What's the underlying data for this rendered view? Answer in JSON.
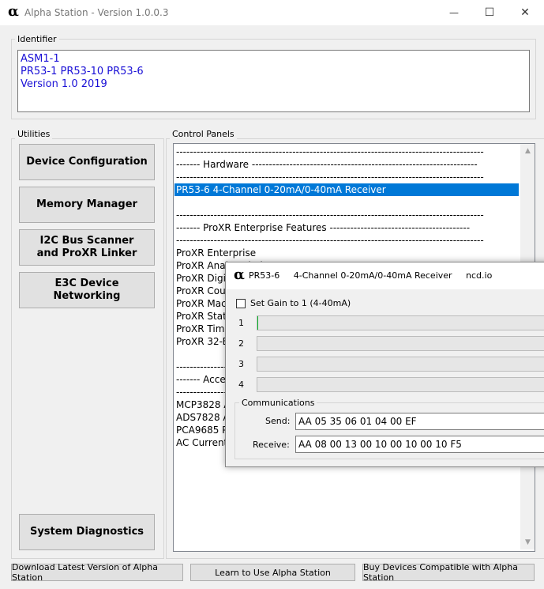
{
  "window": {
    "title": "Alpha Station - Version 1.0.0.3",
    "logo_glyph": "α",
    "minimize_glyph": "—",
    "maximize_glyph": "☐",
    "close_glyph": "✕"
  },
  "identifier": {
    "group_label": "Identifier",
    "lines": [
      "ASM1-1",
      "PR53-1 PR53-10 PR53-6",
      "Version 1.0 2019"
    ],
    "text_color": "#1a10d6"
  },
  "utilities": {
    "group_label": "Utilities",
    "buttons": [
      {
        "label": "Device Configuration"
      },
      {
        "label": "Memory Manager"
      },
      {
        "label": "I2C Bus Scanner and ProXR Linker"
      },
      {
        "label": "E3C Device Networking"
      },
      {
        "label": "System Diagnostics"
      }
    ]
  },
  "control_panels": {
    "group_label": "Control Panels",
    "items": [
      "------------------------------------------------------------------------------------------",
      "-------    Hardware   ------------------------------------------------------------------",
      "------------------------------------------------------------------------------------------",
      "PR53-6    4-Channel 0-20mA/0-40mA Receiver",
      "",
      "------------------------------------------------------------------------------------------",
      "-------    ProXR Enterprise Features   -----------------------------------------",
      "------------------------------------------------------------------------------------------",
      "ProXR Enterprise",
      "ProXR Analog Limits",
      "ProXR Digital",
      "ProXR Counters",
      "ProXR Macros",
      "ProXR Status",
      "ProXR Timers",
      "ProXR 32-Bit",
      "",
      "------------------------------------------------------------------------------------------",
      "-------    Accessories",
      "------------------------------------------------------------------------------------------",
      "MCP3828 ADC",
      "ADS7828 ADC",
      "PCA9685 PWM",
      "AC Current Monitor"
    ],
    "selected_index": 3,
    "selection_color": "#0078d7"
  },
  "footer": {
    "buttons": [
      {
        "label": "Download Latest Version of Alpha Station"
      },
      {
        "label": "Learn to Use Alpha Station"
      },
      {
        "label": "Buy Devices Compatible with Alpha Station"
      }
    ]
  },
  "popup": {
    "logo_glyph": "α",
    "title": "PR53-6     4-Channel 0-20mA/0-40mA Receiver     ncd.io",
    "checkbox_label": "Set Gain to 1 (4-40mA)",
    "checkbox_checked": false,
    "channels": [
      {
        "label": "1",
        "level": 0.0
      },
      {
        "label": "2",
        "level": 0.0
      },
      {
        "label": "3",
        "level": 0.0
      },
      {
        "label": "4",
        "level": 0.0
      }
    ],
    "communications": {
      "group_label": "Communications",
      "send_label": "Send:",
      "send_value": "AA 05 35 06 01 04 00 EF",
      "receive_label": "Receive:",
      "receive_value": "AA 08 00 13 00 10 00 10 00 10 F5"
    }
  }
}
